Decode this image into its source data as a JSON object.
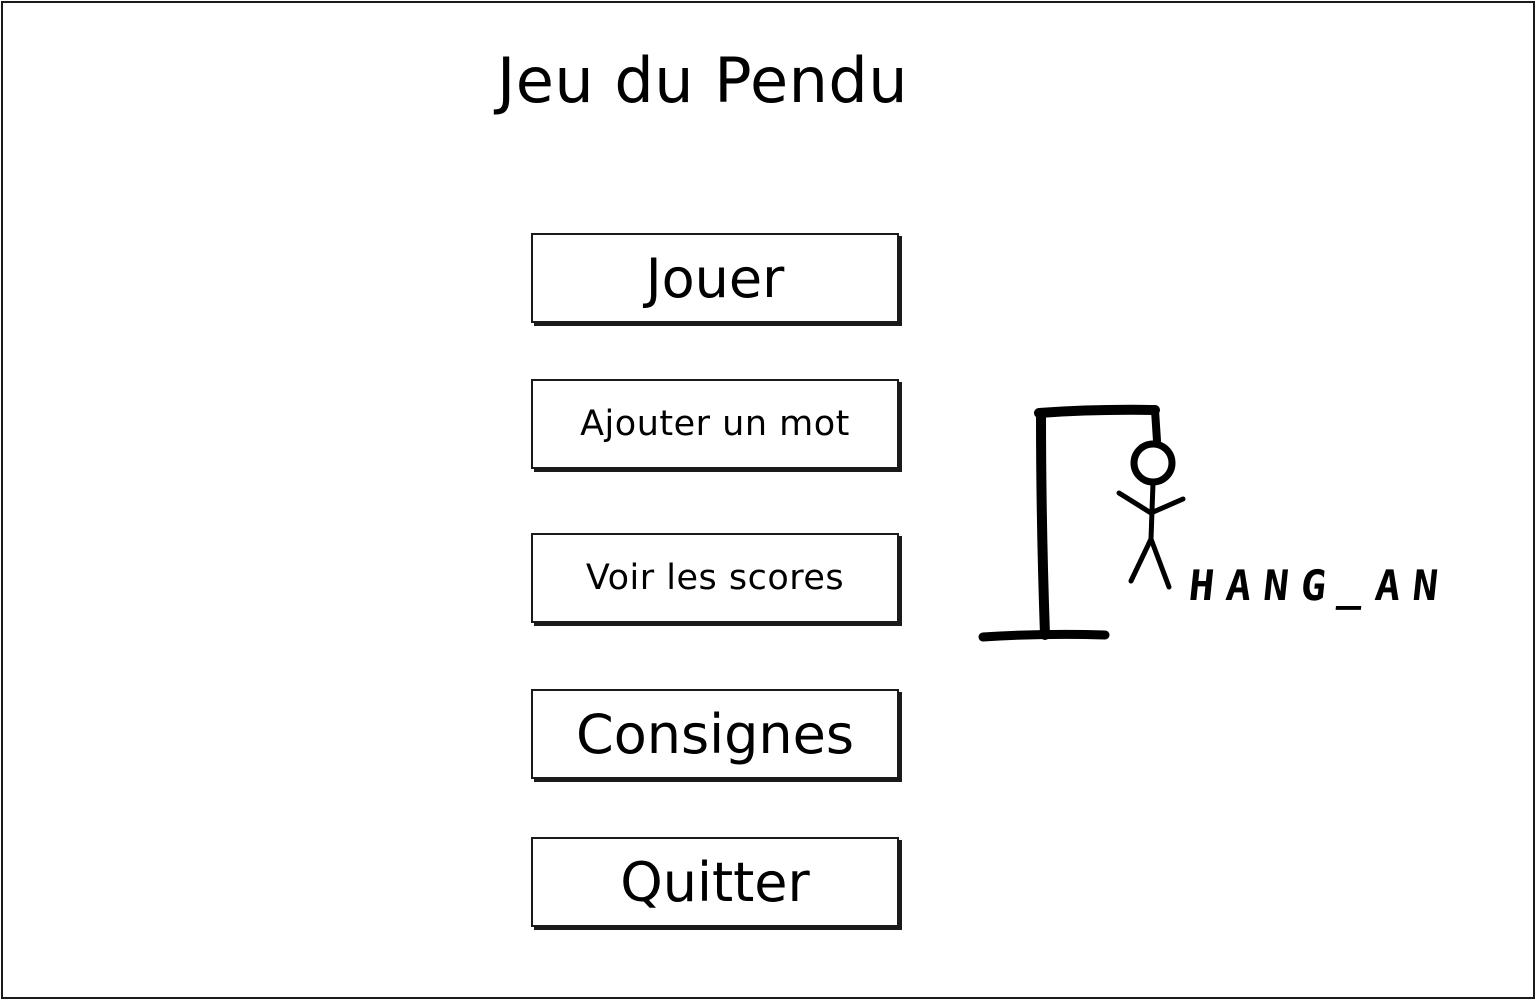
{
  "app": {
    "title": "Jeu du Pendu"
  },
  "menu": {
    "play_label": "Jouer",
    "add_word_label": "Ajouter un mot",
    "scores_label": "Voir les scores",
    "rules_label": "Consignes",
    "quit_label": "Quitter"
  },
  "logo": {
    "word": "HANG_AN",
    "icon": "hangman-gallows-icon"
  },
  "colors": {
    "ink": "#000000",
    "background": "#ffffff"
  }
}
